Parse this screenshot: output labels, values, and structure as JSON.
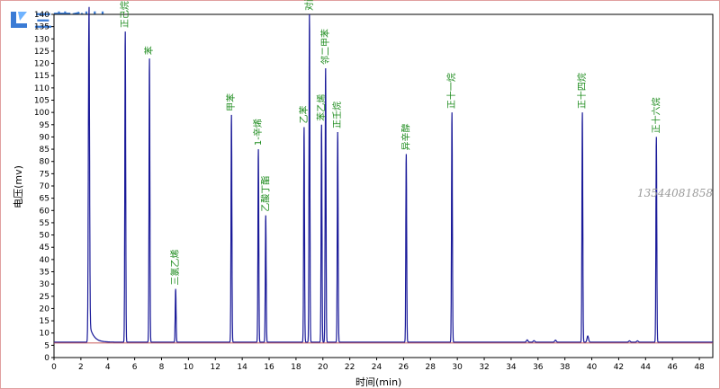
{
  "brand": {
    "logo_text": "三莉科技",
    "accent": "#3a7bd5"
  },
  "watermark": "13544081858",
  "chart_data": {
    "type": "line",
    "xlabel": "时间(min)",
    "ylabel": "电压(mv)",
    "xlim": [
      0,
      49
    ],
    "ylim": [
      0,
      140
    ],
    "xticks": [
      0,
      2,
      4,
      6,
      8,
      10,
      12,
      14,
      16,
      18,
      20,
      22,
      24,
      26,
      28,
      30,
      32,
      34,
      36,
      38,
      40,
      42,
      44,
      46,
      48
    ],
    "yticks": [
      0,
      5,
      10,
      15,
      20,
      25,
      30,
      35,
      40,
      45,
      50,
      55,
      60,
      65,
      70,
      75,
      80,
      85,
      90,
      95,
      100,
      105,
      110,
      115,
      120,
      125,
      130,
      135,
      140
    ],
    "baseline": 6.3,
    "line_color": "#1a1a99",
    "label_color": "#1a8a1a",
    "peaks": [
      {
        "rt": 2.6,
        "height": 140,
        "label": ""
      },
      {
        "rt": 5.3,
        "height": 133,
        "label": "正己烷"
      },
      {
        "rt": 7.1,
        "height": 122,
        "label": "苯"
      },
      {
        "rt": 9.05,
        "height": 28,
        "label": "三氯乙烯"
      },
      {
        "rt": 13.2,
        "height": 99,
        "label": "甲苯"
      },
      {
        "rt": 15.2,
        "height": 85,
        "label": "1-辛烯"
      },
      {
        "rt": 15.75,
        "height": 58,
        "label": "乙酸丁酯"
      },
      {
        "rt": 18.6,
        "height": 94,
        "label": "乙苯"
      },
      {
        "rt": 19.0,
        "height": 140,
        "label": "对间二甲苯"
      },
      {
        "rt": 19.9,
        "height": 95,
        "label": "苯乙烯"
      },
      {
        "rt": 20.2,
        "height": 118,
        "label": "邻二甲苯"
      },
      {
        "rt": 21.1,
        "height": 92,
        "label": "正壬烷"
      },
      {
        "rt": 26.2,
        "height": 83,
        "label": "异辛醇"
      },
      {
        "rt": 29.6,
        "height": 100,
        "label": "正十一烷"
      },
      {
        "rt": 39.3,
        "height": 100,
        "label": "正十四烷"
      },
      {
        "rt": 44.8,
        "height": 90,
        "label": "正十六烷"
      }
    ]
  }
}
